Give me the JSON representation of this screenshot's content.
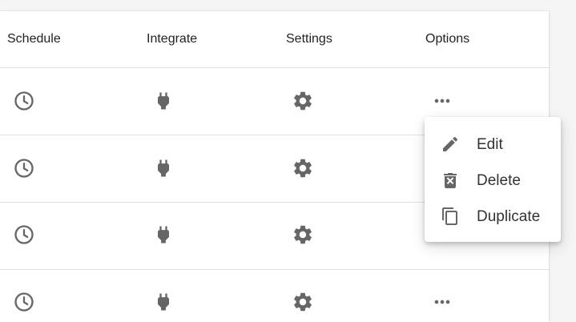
{
  "table": {
    "headers": {
      "schedule": "Schedule",
      "integrate": "Integrate",
      "settings": "Settings",
      "options": "Options"
    },
    "row_count": 4,
    "icons": {
      "schedule": "clock-icon",
      "integrate": "plug-icon",
      "settings": "gear-icon",
      "options": "more-horiz-icon"
    }
  },
  "options_menu": {
    "open": true,
    "items": [
      {
        "label": "Edit",
        "icon": "pencil-icon"
      },
      {
        "label": "Delete",
        "icon": "trash-icon"
      },
      {
        "label": "Duplicate",
        "icon": "copy-icon"
      }
    ]
  },
  "colors": {
    "icon": "#666666",
    "text": "#222222",
    "divider": "#e0e0e0",
    "background": "#f5f5f5",
    "surface": "#ffffff"
  }
}
